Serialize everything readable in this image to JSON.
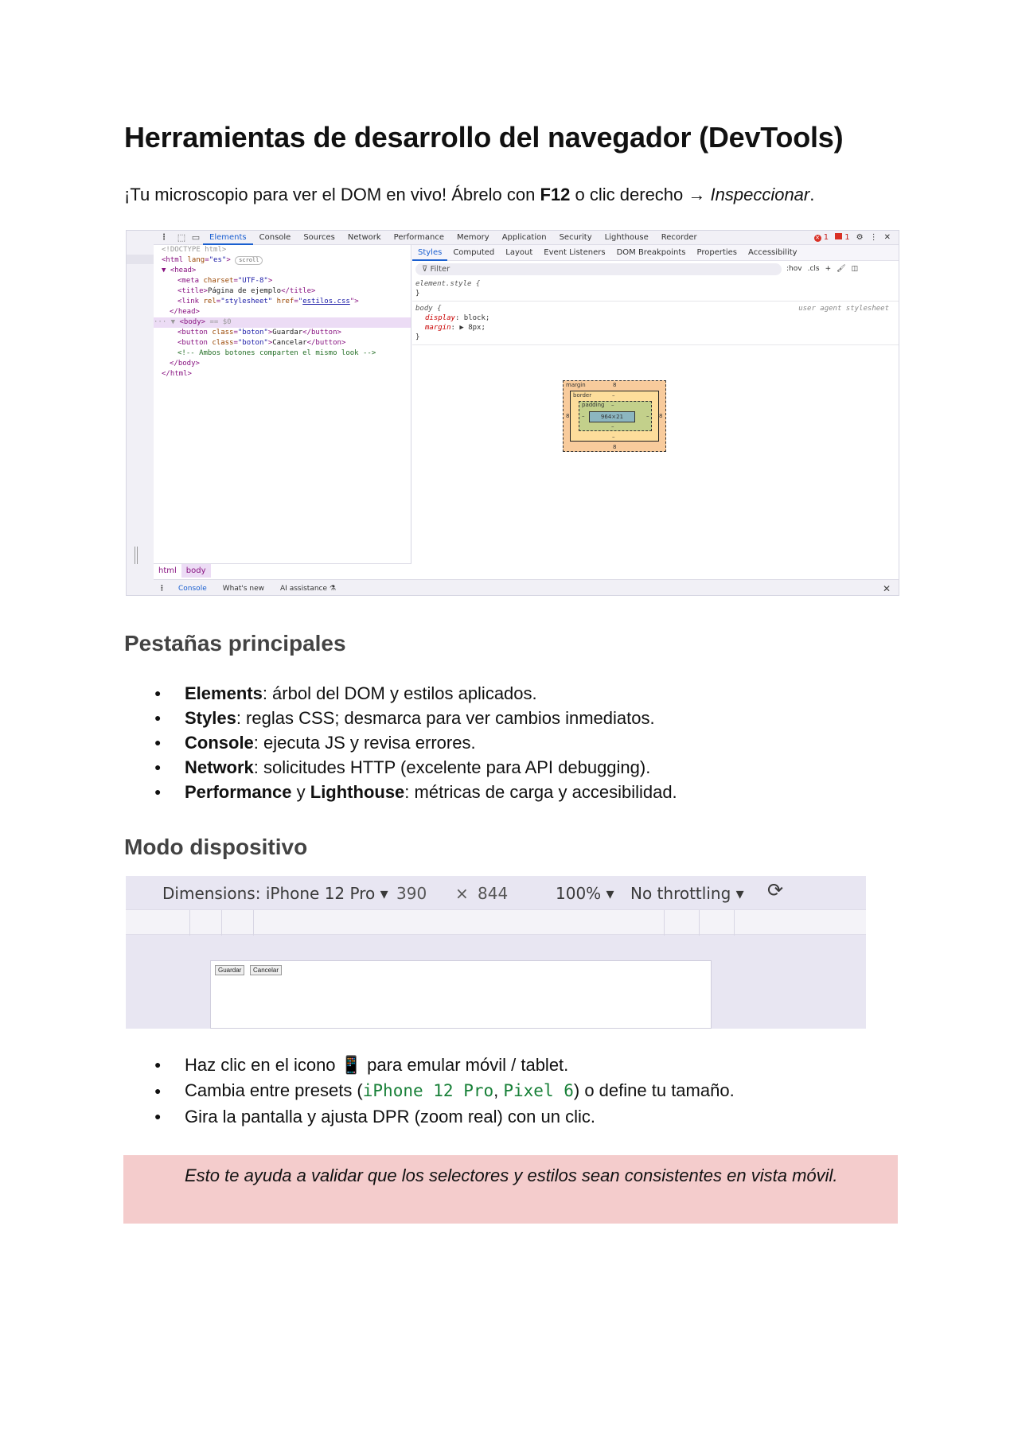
{
  "title": "Herramientas de desarrollo del navegador (DevTools)",
  "intro": {
    "prefix": "¡Tu microscopio para ver el DOM en vivo! Ábrelo con ",
    "key": "F12",
    "middle": " o clic derecho → ",
    "action": "Inspeccionar",
    "suffix": "."
  },
  "devtools": {
    "tabs": [
      "Elements",
      "Console",
      "Sources",
      "Network",
      "Performance",
      "Memory",
      "Application",
      "Security",
      "Lighthouse",
      "Recorder"
    ],
    "active_tab": "Elements",
    "error_count": "1",
    "issue_count": "1",
    "code": {
      "doctype": "<!DOCTYPE html>",
      "html_open": "<html ",
      "html_attr": "lang",
      "html_val": "\"es\"",
      "html_close": ">",
      "scroll_pill": "scroll",
      "head_open": "▼ <head>",
      "meta_tag": "<meta ",
      "meta_attr": "charset",
      "meta_val": "\"UTF-8\"",
      "meta_end": ">",
      "title_open": "<title>",
      "title_text": "Página de ejemplo",
      "title_close": "</title>",
      "link_tag": "<link ",
      "link_rel": "rel",
      "link_rel_val": "\"stylesheet\"",
      "link_href": "href",
      "link_href_q": "\"",
      "link_href_val": "estilos.css",
      "link_end": "\">",
      "head_close": "</head>",
      "body_prefix": "··· ▼ ",
      "body_open": "<body>",
      "body_eq": " == $0",
      "btn_open": "<button ",
      "btn_attr": "class",
      "btn_val": "\"boton\"",
      "btn_gt": ">",
      "btn1_text": "Guardar",
      "btn2_text": "Cancelar",
      "btn_close": "</button>",
      "comment": "<!-- Ambos botones comparten el mismo look -->",
      "body_close": "</body>",
      "html_end": "</html>"
    },
    "breadcrumb": [
      "html",
      "body"
    ],
    "styles_tabs": [
      "Styles",
      "Computed",
      "Layout",
      "Event Listeners",
      "DOM Breakpoints",
      "Properties",
      "Accessibility"
    ],
    "filter_placeholder": "Filter",
    "filter_tools": [
      ":hov",
      ".cls",
      "+"
    ],
    "element_style": "element.style {",
    "close_brace": "}",
    "body_rule": "body {",
    "ua_label": "user agent stylesheet",
    "decl_display_prop": "display",
    "decl_display_val": ": block;",
    "decl_margin_prop": "margin",
    "decl_margin_val": ": ▶ 8px;",
    "box": {
      "margin_label": "margin",
      "margin_val": "8",
      "border_label": "border",
      "border_val": "–",
      "padding_label": "padding",
      "padding_val": "–",
      "content": "964×21",
      "side_val": "8",
      "dash": "–"
    },
    "drawer_tabs": [
      "Console",
      "What's new",
      "AI assistance"
    ]
  },
  "section_tabs": {
    "heading": "Pestañas principales",
    "items": [
      {
        "bold": "Elements",
        "text": ": árbol del DOM y estilos aplicados."
      },
      {
        "bold": "Styles",
        "text": ": reglas CSS; desmarca para ver cambios inmediatos."
      },
      {
        "bold": "Console",
        "text": ": ejecuta JS y revisa errores."
      },
      {
        "bold": "Network",
        "text": ": solicitudes HTTP (excelente para API debugging)."
      },
      {
        "bold": "Performance",
        "mid": " y ",
        "bold2": "Lighthouse",
        "text": ": métricas de carga y accesibilidad."
      }
    ]
  },
  "section_device": {
    "heading": "Modo dispositivo",
    "toolbar": {
      "dimensions": "Dimensions: iPhone 12 Pro ▾",
      "width": "390",
      "times": "×",
      "height": "844",
      "zoom": "100% ▾",
      "throttling": "No throttling ▾"
    },
    "preview_buttons": [
      "Guardar",
      "Cancelar"
    ],
    "bullets": [
      {
        "a": "Haz clic en el icono ",
        "icon": "📱",
        "b": " para emular móvil / tablet."
      },
      {
        "a": "Cambia entre presets (",
        "code1": "iPhone 12 Pro",
        "sep": ", ",
        "code2": "Pixel 6",
        "b": ") o define tu tamaño."
      },
      {
        "a": "Gira la pantalla y ajusta DPR (zoom real) con un clic."
      }
    ]
  },
  "callout": "Esto te ayuda a validar que los selectores y estilos sean consistentes en vista móvil."
}
